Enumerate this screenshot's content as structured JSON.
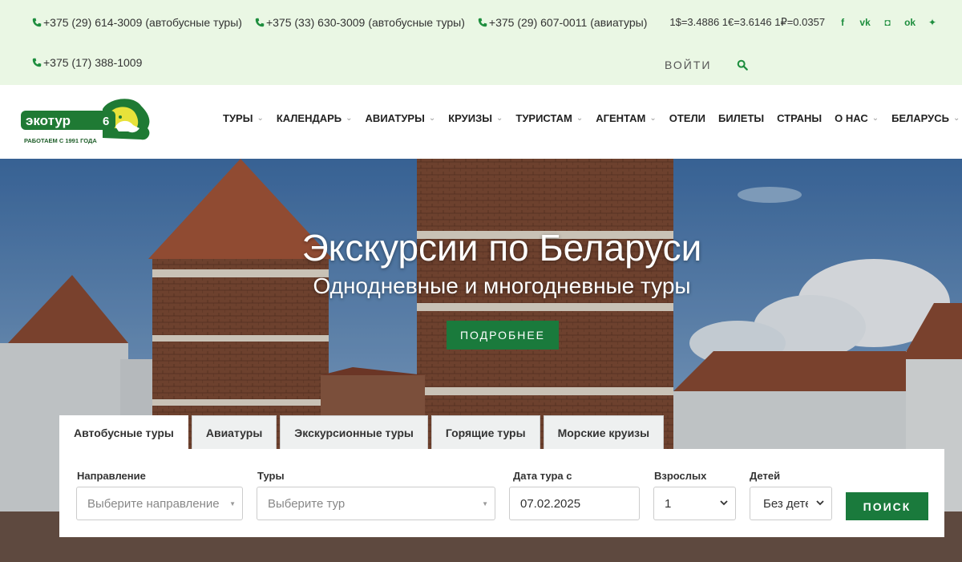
{
  "topbar": {
    "phones_row1": [
      {
        "number": "+375 (29) 614-3009",
        "note": "(автобусные туры)"
      },
      {
        "number": "+375 (33) 630-3009",
        "note": "(автобусные туры)"
      },
      {
        "number": "+375 (29) 607-0011",
        "note": "(авиатуры)"
      }
    ],
    "rates": "1$=3.4886 1€=3.6146 1₽=0.0357",
    "socials": [
      {
        "icon": "facebook-icon",
        "glyph": "f"
      },
      {
        "icon": "vk-icon",
        "glyph": "vk"
      },
      {
        "icon": "instagram-icon",
        "glyph": "◘"
      },
      {
        "icon": "odnoklassniki-icon",
        "glyph": "ok"
      },
      {
        "icon": "twitter-icon",
        "glyph": "✦"
      }
    ],
    "phone_row2": {
      "number": "+375 (17) 388-1009"
    },
    "login_label": "ВОЙТИ",
    "accent_color": "#1e8e3e"
  },
  "header": {
    "logo_text": "экотур",
    "logo_number": "6",
    "logo_tagline": "РАБОТАЕМ С 1991 ГОДА",
    "nav": [
      {
        "label": "ТУРЫ",
        "dropdown": true
      },
      {
        "label": "КАЛЕНДАРЬ",
        "dropdown": true
      },
      {
        "label": "АВИАТУРЫ",
        "dropdown": true
      },
      {
        "label": "КРУИЗЫ",
        "dropdown": true
      },
      {
        "label": "ТУРИСТАМ",
        "dropdown": true
      },
      {
        "label": "АГЕНТАМ",
        "dropdown": true
      },
      {
        "label": "ОТЕЛИ",
        "dropdown": false
      },
      {
        "label": "БИЛЕТЫ",
        "dropdown": false
      },
      {
        "label": "СТРАНЫ",
        "dropdown": false
      },
      {
        "label": "О НАС",
        "dropdown": true
      },
      {
        "label": "БЕЛАРУСЬ",
        "dropdown": true
      }
    ]
  },
  "hero": {
    "title": "Экскурсии по Беларуси",
    "subtitle": "Однодневные и многодневные туры",
    "button_label": "ПОДРОБНЕЕ",
    "button_color": "#1a7a3c"
  },
  "search": {
    "tabs": [
      {
        "label": "Автобусные туры",
        "active": true
      },
      {
        "label": "Авиатуры",
        "active": false
      },
      {
        "label": "Экскурсионные туры",
        "active": false
      },
      {
        "label": "Горящие туры",
        "active": false
      },
      {
        "label": "Морские круизы",
        "active": false
      }
    ],
    "direction_label": "Направление",
    "direction_placeholder": "Выберите направление",
    "tours_label": "Туры",
    "tours_placeholder": "Выберите тур",
    "date_label": "Дата тура с",
    "date_value": "07.02.2025",
    "adults_label": "Взрослых",
    "adults_value": "1",
    "children_label": "Детей",
    "children_value": "Без детей",
    "submit_label": "ПОИСК"
  }
}
